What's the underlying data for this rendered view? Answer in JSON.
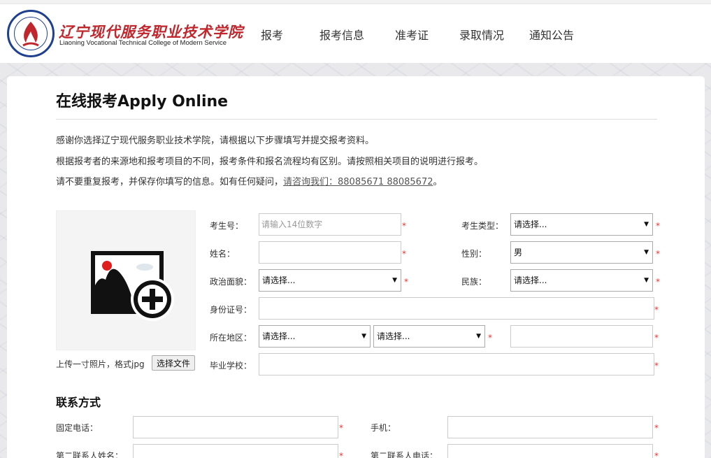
{
  "header": {
    "school_name_cn": "辽宁现代服务职业技术学院",
    "school_name_en": "Liaoning Vocational Technical College of Modern Service",
    "nav": [
      "报考",
      "报考信息",
      "准考证",
      "录取情况",
      "通知公告"
    ]
  },
  "page": {
    "title": "在线报考Apply Online",
    "intro": [
      "感谢你选择辽宁现代服务职业技术学院，请根据以下步骤填写并提交报考资料。",
      "根据报考者的来源地和报考项目的不同，报考条件和报名流程均有区别。请按照相关项目的说明进行报考。"
    ],
    "intro3_prefix": "请不要重复报考，并保存你填写的信息。如有任何疑问，",
    "intro3_link": "请咨询我们：88085671 88085672",
    "intro3_suffix": "。"
  },
  "photo": {
    "label": "上传一寸照片，格式jpg",
    "button": "选择文件"
  },
  "form": {
    "exam_no_label": "考生号：",
    "exam_no_placeholder": "请输入14位数字",
    "candidate_type_label": "考生类型：",
    "candidate_type_value": "请选择...",
    "name_label": "姓名：",
    "gender_label": "性别：",
    "gender_value": "男",
    "political_label": "政治面貌：",
    "political_value": "请选择...",
    "ethnicity_label": "民族：",
    "ethnicity_value": "请选择...",
    "id_label": "身份证号：",
    "region_label": "所在地区：",
    "region_province": "请选择...",
    "region_city": "请选择...",
    "school_label": "毕业学校：",
    "required_mark": "*"
  },
  "contact": {
    "title": "联系方式",
    "landline_label": "固定电话：",
    "mobile_label": "手机：",
    "contact2_name_label": "第二联系人姓名：",
    "contact2_phone_label": "第二联系人电话："
  },
  "colors": {
    "required": "#e33333",
    "brand_red": "#c0272d",
    "brand_blue": "#1f3f8f"
  }
}
